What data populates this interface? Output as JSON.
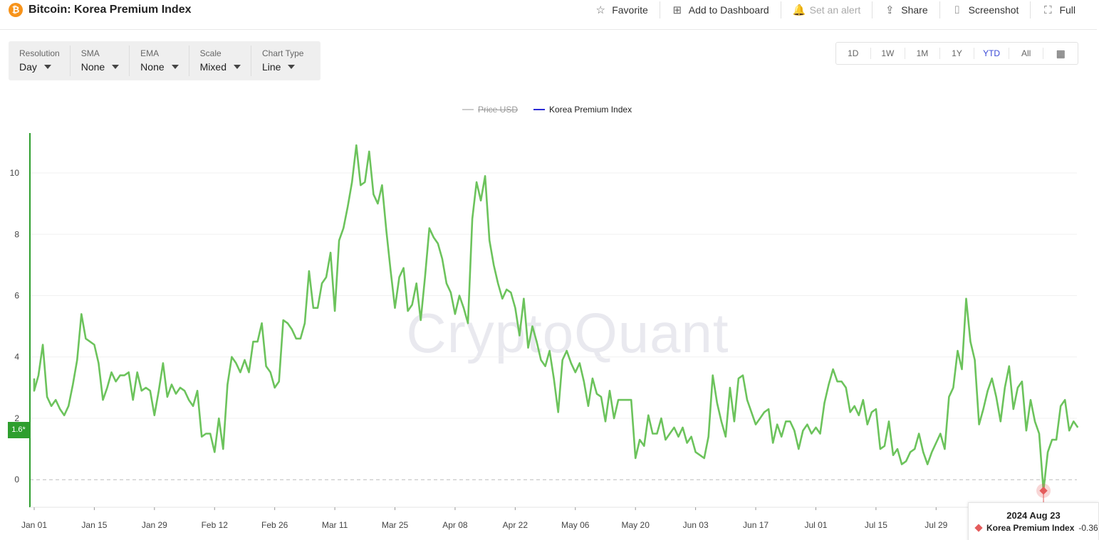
{
  "header": {
    "logo_glyph": "₿",
    "title": "Bitcoin: Korea Premium Index",
    "actions": [
      {
        "label": "Favorite",
        "icon": "star-icon",
        "glyph": "☆",
        "enabled": true
      },
      {
        "label": "Add to Dashboard",
        "icon": "dashboard-add-icon",
        "glyph": "⊞",
        "enabled": true
      },
      {
        "label": "Set an alert",
        "icon": "bell-icon",
        "glyph": "🔔",
        "enabled": false
      },
      {
        "label": "Share",
        "icon": "share-icon",
        "glyph": "⇪",
        "enabled": true
      },
      {
        "label": "Screenshot",
        "icon": "camera-icon",
        "glyph": "⌷",
        "enabled": true
      },
      {
        "label": "Full",
        "icon": "fullscreen-icon",
        "glyph": "⛶",
        "enabled": true
      }
    ]
  },
  "controls": [
    {
      "label": "Resolution",
      "value": "Day"
    },
    {
      "label": "SMA",
      "value": "None"
    },
    {
      "label": "EMA",
      "value": "None"
    },
    {
      "label": "Scale",
      "value": "Mixed"
    },
    {
      "label": "Chart Type",
      "value": "Line"
    }
  ],
  "ranges": {
    "items": [
      "1D",
      "1W",
      "1M",
      "1Y",
      "YTD",
      "All"
    ],
    "active": "YTD",
    "calendar_icon": "calendar-icon"
  },
  "legend": [
    {
      "label": "Price USD",
      "color": "#cccccc",
      "enabled": false
    },
    {
      "label": "Korea Premium Index",
      "color": "#2b2bd6",
      "enabled": true
    }
  ],
  "watermark": "CryptoQuant",
  "current_value_tag": "1.6*",
  "tooltip": {
    "date": "2024 Aug 23",
    "series": "Korea Premium Index",
    "value": "-0.36",
    "marker_color": "#e45c5c"
  },
  "colors": {
    "line": "#6cc35c",
    "axis": "#2e9e2e",
    "zero_line": "#bbbbbb",
    "active_range": "#3a49d6"
  },
  "chart_data": {
    "type": "line",
    "title": "Bitcoin: Korea Premium Index",
    "xlabel": "",
    "ylabel": "",
    "ylim": [
      -0.9,
      11.3
    ],
    "yticks": [
      0,
      2,
      4,
      6,
      8,
      10
    ],
    "xtick_labels": [
      "Jan 01",
      "Jan 15",
      "Jan 29",
      "Feb 12",
      "Feb 26",
      "Mar 11",
      "Mar 25",
      "Apr 08",
      "Apr 22",
      "May 06",
      "May 20",
      "Jun 03",
      "Jun 17",
      "Jul 01",
      "Jul 15",
      "Jul 29"
    ],
    "xlim": [
      "2024-01-01",
      "2024-08-31"
    ],
    "grid": true,
    "legend_position": "top-center",
    "series": [
      {
        "name": "Korea Premium Index",
        "color": "#6cc35c",
        "points": [
          [
            "2024-01-01",
            3.3
          ],
          [
            "2024-01-01",
            2.9
          ],
          [
            "2024-01-02",
            3.4
          ],
          [
            "2024-01-03",
            4.4
          ],
          [
            "2024-01-04",
            2.7
          ],
          [
            "2024-01-05",
            2.4
          ],
          [
            "2024-01-06",
            2.6
          ],
          [
            "2024-01-07",
            2.3
          ],
          [
            "2024-01-08",
            2.1
          ],
          [
            "2024-01-09",
            2.4
          ],
          [
            "2024-01-10",
            3.1
          ],
          [
            "2024-01-11",
            3.9
          ],
          [
            "2024-01-12",
            5.4
          ],
          [
            "2024-01-13",
            4.6
          ],
          [
            "2024-01-14",
            4.5
          ],
          [
            "2024-01-15",
            4.4
          ],
          [
            "2024-01-16",
            3.8
          ],
          [
            "2024-01-17",
            2.6
          ],
          [
            "2024-01-18",
            3.0
          ],
          [
            "2024-01-19",
            3.5
          ],
          [
            "2024-01-20",
            3.2
          ],
          [
            "2024-01-21",
            3.4
          ],
          [
            "2024-01-22",
            3.4
          ],
          [
            "2024-01-23",
            3.5
          ],
          [
            "2024-01-24",
            2.6
          ],
          [
            "2024-01-25",
            3.5
          ],
          [
            "2024-01-26",
            2.9
          ],
          [
            "2024-01-27",
            3.0
          ],
          [
            "2024-01-28",
            2.9
          ],
          [
            "2024-01-29",
            2.1
          ],
          [
            "2024-01-30",
            2.9
          ],
          [
            "2024-01-31",
            3.8
          ],
          [
            "2024-02-01",
            2.7
          ],
          [
            "2024-02-02",
            3.1
          ],
          [
            "2024-02-03",
            2.8
          ],
          [
            "2024-02-04",
            3.0
          ],
          [
            "2024-02-05",
            2.9
          ],
          [
            "2024-02-06",
            2.6
          ],
          [
            "2024-02-07",
            2.4
          ],
          [
            "2024-02-08",
            2.9
          ],
          [
            "2024-02-09",
            1.4
          ],
          [
            "2024-02-10",
            1.5
          ],
          [
            "2024-02-11",
            1.5
          ],
          [
            "2024-02-12",
            0.9
          ],
          [
            "2024-02-13",
            2.0
          ],
          [
            "2024-02-14",
            1.0
          ],
          [
            "2024-02-15",
            3.1
          ],
          [
            "2024-02-16",
            4.0
          ],
          [
            "2024-02-17",
            3.8
          ],
          [
            "2024-02-18",
            3.5
          ],
          [
            "2024-02-19",
            3.9
          ],
          [
            "2024-02-20",
            3.5
          ],
          [
            "2024-02-21",
            4.5
          ],
          [
            "2024-02-22",
            4.5
          ],
          [
            "2024-02-23",
            5.1
          ],
          [
            "2024-02-24",
            3.7
          ],
          [
            "2024-02-25",
            3.5
          ],
          [
            "2024-02-26",
            3.0
          ],
          [
            "2024-02-27",
            3.2
          ],
          [
            "2024-02-28",
            5.2
          ],
          [
            "2024-02-29",
            5.1
          ],
          [
            "2024-03-01",
            4.9
          ],
          [
            "2024-03-02",
            4.6
          ],
          [
            "2024-03-03",
            4.6
          ],
          [
            "2024-03-04",
            5.1
          ],
          [
            "2024-03-05",
            6.8
          ],
          [
            "2024-03-06",
            5.6
          ],
          [
            "2024-03-07",
            5.6
          ],
          [
            "2024-03-08",
            6.4
          ],
          [
            "2024-03-09",
            6.6
          ],
          [
            "2024-03-10",
            7.4
          ],
          [
            "2024-03-11",
            5.5
          ],
          [
            "2024-03-12",
            7.8
          ],
          [
            "2024-03-13",
            8.2
          ],
          [
            "2024-03-14",
            8.9
          ],
          [
            "2024-03-15",
            9.7
          ],
          [
            "2024-03-16",
            10.9
          ],
          [
            "2024-03-17",
            9.6
          ],
          [
            "2024-03-18",
            9.7
          ],
          [
            "2024-03-19",
            10.7
          ],
          [
            "2024-03-20",
            9.3
          ],
          [
            "2024-03-21",
            9.0
          ],
          [
            "2024-03-22",
            9.6
          ],
          [
            "2024-03-23",
            8.1
          ],
          [
            "2024-03-24",
            6.8
          ],
          [
            "2024-03-25",
            5.6
          ],
          [
            "2024-03-26",
            6.6
          ],
          [
            "2024-03-27",
            6.9
          ],
          [
            "2024-03-28",
            5.5
          ],
          [
            "2024-03-29",
            5.7
          ],
          [
            "2024-03-30",
            6.4
          ],
          [
            "2024-03-31",
            5.2
          ],
          [
            "2024-04-01",
            6.6
          ],
          [
            "2024-04-02",
            8.2
          ],
          [
            "2024-04-03",
            7.9
          ],
          [
            "2024-04-04",
            7.7
          ],
          [
            "2024-04-05",
            7.2
          ],
          [
            "2024-04-06",
            6.4
          ],
          [
            "2024-04-07",
            6.1
          ],
          [
            "2024-04-08",
            5.4
          ],
          [
            "2024-04-09",
            6.0
          ],
          [
            "2024-04-10",
            5.6
          ],
          [
            "2024-04-11",
            5.1
          ],
          [
            "2024-04-12",
            8.5
          ],
          [
            "2024-04-13",
            9.7
          ],
          [
            "2024-04-14",
            9.1
          ],
          [
            "2024-04-15",
            9.9
          ],
          [
            "2024-04-16",
            7.8
          ],
          [
            "2024-04-17",
            7.0
          ],
          [
            "2024-04-18",
            6.4
          ],
          [
            "2024-04-19",
            5.9
          ],
          [
            "2024-04-20",
            6.2
          ],
          [
            "2024-04-21",
            6.1
          ],
          [
            "2024-04-22",
            5.6
          ],
          [
            "2024-04-23",
            4.7
          ],
          [
            "2024-04-24",
            5.9
          ],
          [
            "2024-04-25",
            4.3
          ],
          [
            "2024-04-26",
            5.0
          ],
          [
            "2024-04-27",
            4.5
          ],
          [
            "2024-04-28",
            3.9
          ],
          [
            "2024-04-29",
            3.7
          ],
          [
            "2024-04-30",
            4.2
          ],
          [
            "2024-05-01",
            3.3
          ],
          [
            "2024-05-02",
            2.2
          ],
          [
            "2024-05-03",
            3.9
          ],
          [
            "2024-05-04",
            4.2
          ],
          [
            "2024-05-05",
            3.8
          ],
          [
            "2024-05-06",
            3.5
          ],
          [
            "2024-05-07",
            3.8
          ],
          [
            "2024-05-08",
            3.2
          ],
          [
            "2024-05-09",
            2.4
          ],
          [
            "2024-05-10",
            3.3
          ],
          [
            "2024-05-11",
            2.8
          ],
          [
            "2024-05-12",
            2.7
          ],
          [
            "2024-05-13",
            1.9
          ],
          [
            "2024-05-14",
            2.9
          ],
          [
            "2024-05-15",
            2.0
          ],
          [
            "2024-05-16",
            2.6
          ],
          [
            "2024-05-17",
            2.6
          ],
          [
            "2024-05-18",
            2.6
          ],
          [
            "2024-05-19",
            2.6
          ],
          [
            "2024-05-20",
            0.7
          ],
          [
            "2024-05-21",
            1.3
          ],
          [
            "2024-05-22",
            1.1
          ],
          [
            "2024-05-23",
            2.1
          ],
          [
            "2024-05-24",
            1.5
          ],
          [
            "2024-05-25",
            1.5
          ],
          [
            "2024-05-26",
            2.0
          ],
          [
            "2024-05-27",
            1.3
          ],
          [
            "2024-05-28",
            1.5
          ],
          [
            "2024-05-29",
            1.7
          ],
          [
            "2024-05-30",
            1.4
          ],
          [
            "2024-05-31",
            1.7
          ],
          [
            "2024-06-01",
            1.2
          ],
          [
            "2024-06-02",
            1.4
          ],
          [
            "2024-06-03",
            0.9
          ],
          [
            "2024-06-04",
            0.8
          ],
          [
            "2024-06-05",
            0.7
          ],
          [
            "2024-06-06",
            1.4
          ],
          [
            "2024-06-07",
            3.4
          ],
          [
            "2024-06-08",
            2.5
          ],
          [
            "2024-06-09",
            1.9
          ],
          [
            "2024-06-10",
            1.4
          ],
          [
            "2024-06-11",
            3.0
          ],
          [
            "2024-06-12",
            1.9
          ],
          [
            "2024-06-13",
            3.3
          ],
          [
            "2024-06-14",
            3.4
          ],
          [
            "2024-06-15",
            2.6
          ],
          [
            "2024-06-16",
            2.2
          ],
          [
            "2024-06-17",
            1.8
          ],
          [
            "2024-06-18",
            2.0
          ],
          [
            "2024-06-19",
            2.2
          ],
          [
            "2024-06-20",
            2.3
          ],
          [
            "2024-06-21",
            1.2
          ],
          [
            "2024-06-22",
            1.8
          ],
          [
            "2024-06-23",
            1.4
          ],
          [
            "2024-06-24",
            1.9
          ],
          [
            "2024-06-25",
            1.9
          ],
          [
            "2024-06-26",
            1.6
          ],
          [
            "2024-06-27",
            1.0
          ],
          [
            "2024-06-28",
            1.6
          ],
          [
            "2024-06-29",
            1.8
          ],
          [
            "2024-06-30",
            1.5
          ],
          [
            "2024-07-01",
            1.7
          ],
          [
            "2024-07-02",
            1.5
          ],
          [
            "2024-07-03",
            2.5
          ],
          [
            "2024-07-04",
            3.1
          ],
          [
            "2024-07-05",
            3.6
          ],
          [
            "2024-07-06",
            3.2
          ],
          [
            "2024-07-07",
            3.2
          ],
          [
            "2024-07-08",
            3.0
          ],
          [
            "2024-07-09",
            2.2
          ],
          [
            "2024-07-10",
            2.4
          ],
          [
            "2024-07-11",
            2.1
          ],
          [
            "2024-07-12",
            2.6
          ],
          [
            "2024-07-13",
            1.8
          ],
          [
            "2024-07-14",
            2.2
          ],
          [
            "2024-07-15",
            2.3
          ],
          [
            "2024-07-16",
            1.0
          ],
          [
            "2024-07-17",
            1.1
          ],
          [
            "2024-07-18",
            1.9
          ],
          [
            "2024-07-19",
            0.8
          ],
          [
            "2024-07-20",
            1.0
          ],
          [
            "2024-07-21",
            0.5
          ],
          [
            "2024-07-22",
            0.6
          ],
          [
            "2024-07-23",
            0.9
          ],
          [
            "2024-07-24",
            1.0
          ],
          [
            "2024-07-25",
            1.5
          ],
          [
            "2024-07-26",
            0.9
          ],
          [
            "2024-07-27",
            0.5
          ],
          [
            "2024-07-28",
            0.9
          ],
          [
            "2024-07-29",
            1.2
          ],
          [
            "2024-07-30",
            1.5
          ],
          [
            "2024-07-31",
            1.0
          ],
          [
            "2024-08-01",
            2.7
          ],
          [
            "2024-08-02",
            3.0
          ],
          [
            "2024-08-03",
            4.2
          ],
          [
            "2024-08-04",
            3.6
          ],
          [
            "2024-08-05",
            5.9
          ],
          [
            "2024-08-06",
            4.5
          ],
          [
            "2024-08-07",
            3.9
          ],
          [
            "2024-08-08",
            1.8
          ],
          [
            "2024-08-09",
            2.3
          ],
          [
            "2024-08-10",
            2.9
          ],
          [
            "2024-08-11",
            3.3
          ],
          [
            "2024-08-12",
            2.7
          ],
          [
            "2024-08-13",
            1.9
          ],
          [
            "2024-08-14",
            3.0
          ],
          [
            "2024-08-15",
            3.7
          ],
          [
            "2024-08-16",
            2.3
          ],
          [
            "2024-08-17",
            3.0
          ],
          [
            "2024-08-18",
            3.2
          ],
          [
            "2024-08-19",
            1.6
          ],
          [
            "2024-08-20",
            2.6
          ],
          [
            "2024-08-21",
            1.9
          ],
          [
            "2024-08-22",
            1.5
          ],
          [
            "2024-08-23",
            -0.36
          ],
          [
            "2024-08-24",
            0.9
          ],
          [
            "2024-08-25",
            1.3
          ],
          [
            "2024-08-26",
            1.3
          ],
          [
            "2024-08-27",
            2.4
          ],
          [
            "2024-08-28",
            2.6
          ],
          [
            "2024-08-29",
            1.6
          ],
          [
            "2024-08-30",
            1.9
          ],
          [
            "2024-08-31",
            1.7
          ]
        ]
      }
    ],
    "reference_lines": [
      {
        "y": 0,
        "style": "dashed"
      }
    ],
    "highlight": {
      "date": "2024-08-23",
      "value": -0.36
    }
  }
}
